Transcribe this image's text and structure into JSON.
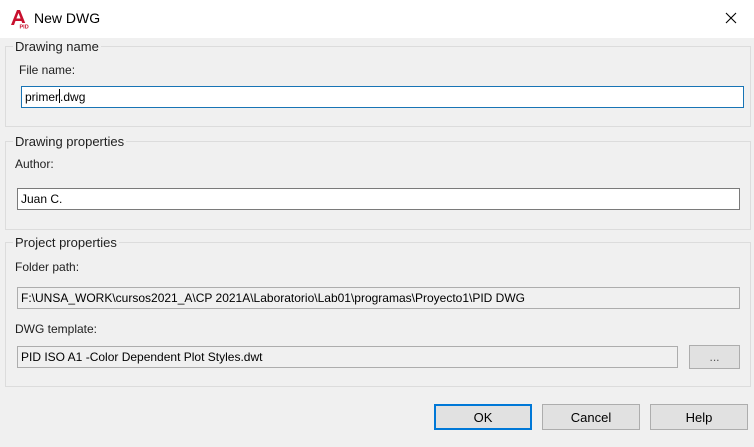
{
  "window": {
    "title": "New DWG",
    "app_icon": "autocad-a-icon",
    "close_icon": "close-icon"
  },
  "drawing_name": {
    "legend": "Drawing name",
    "file_name_label": "File name:",
    "file_name_value_before_caret": "primer",
    "file_name_value_after_caret": ".dwg"
  },
  "drawing_properties": {
    "legend": "Drawing properties",
    "author_label": "Author:",
    "author_value": "Juan C."
  },
  "project_properties": {
    "legend": "Project properties",
    "folder_path_label": "Folder path:",
    "folder_path_value": "F:\\UNSA_WORK\\cursos2021_A\\CP 2021A\\Laboratorio\\Lab01\\programas\\Proyecto1\\PID DWG",
    "template_label": "DWG template:",
    "template_value": "PID ISO A1 -Color Dependent Plot Styles.dwt",
    "browse_label": "..."
  },
  "buttons": {
    "ok": "OK",
    "cancel": "Cancel",
    "help": "Help"
  },
  "colors": {
    "accent": "#0078d7",
    "focus_border": "#1874b5",
    "icon_red": "#c8102e"
  }
}
